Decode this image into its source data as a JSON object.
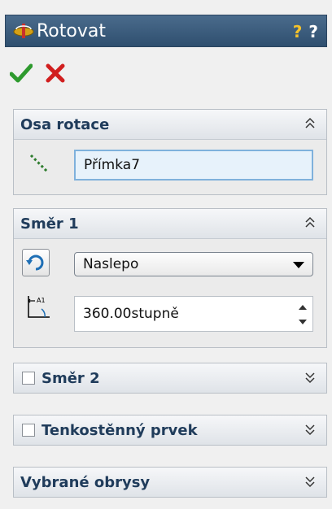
{
  "window": {
    "title": "Rotovat"
  },
  "title_icons": [
    "revolve-feature-icon",
    "help-icon-1",
    "help-icon-2"
  ],
  "title_help": {
    "q1": "?",
    "q2": "?"
  },
  "confirm": {
    "ok": "ok-checkmark-icon",
    "cancel": "cancel-x-icon"
  },
  "sections": {
    "axis": {
      "title": "Osa rotace",
      "value": "Přímka7"
    },
    "dir1": {
      "title": "Směr 1",
      "type": "Naslepo",
      "angle": "360.00stupně"
    },
    "dir2": {
      "title": "Směr 2",
      "checked": false
    },
    "thin": {
      "title": "Tenkostěnný prvek",
      "checked": false
    },
    "contours": {
      "title": "Vybrané obrysy"
    }
  },
  "colors": {
    "titlebar": "#3a5a7a",
    "panel_header_text": "#203c5b",
    "selected_field_border": "#7fb1dc",
    "ok_green": "#2e9a2e",
    "cancel_red": "#d11f1f"
  }
}
